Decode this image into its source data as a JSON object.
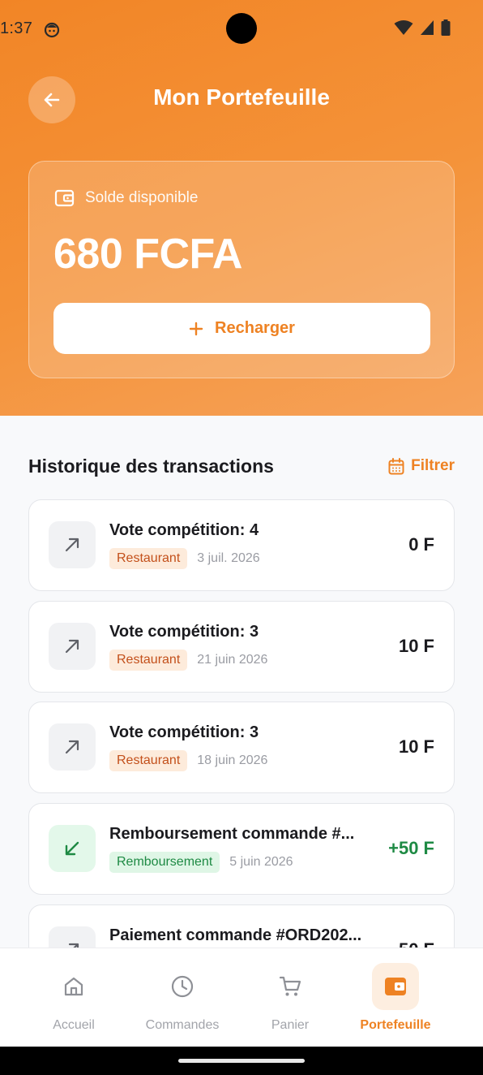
{
  "status_bar": {
    "time": "1:37"
  },
  "header": {
    "title": "Mon Portefeuille"
  },
  "balance": {
    "label": "Solde disponible",
    "amount": "680 FCFA",
    "recharge_label": "Recharger"
  },
  "history": {
    "title": "Historique des transactions",
    "filter_label": "Filtrer"
  },
  "transactions": [
    {
      "title": "Vote compétition: 4",
      "badge": "Restaurant",
      "date": "3 juil. 2026",
      "amount": "0 F",
      "direction": "out"
    },
    {
      "title": "Vote compétition: 3",
      "badge": "Restaurant",
      "date": "21 juin 2026",
      "amount": "10 F",
      "direction": "out"
    },
    {
      "title": "Vote compétition: 3",
      "badge": "Restaurant",
      "date": "18 juin 2026",
      "amount": "10 F",
      "direction": "out"
    },
    {
      "title": "Remboursement commande #...",
      "badge": "Remboursement",
      "date": "5 juin 2026",
      "amount": "+50 F",
      "direction": "in"
    },
    {
      "title": "Paiement commande #ORD202...",
      "badge": "",
      "date": "",
      "amount": "50 F",
      "direction": "out"
    }
  ],
  "bottom_nav": {
    "items": [
      {
        "label": "Accueil",
        "icon": "home-icon"
      },
      {
        "label": "Commandes",
        "icon": "clock-icon"
      },
      {
        "label": "Panier",
        "icon": "cart-icon"
      },
      {
        "label": "Portefeuille",
        "icon": "wallet-icon"
      }
    ],
    "active": "Portefeuille"
  },
  "colors": {
    "primary": "#EE8223",
    "positive": "#1E8A44",
    "badge_restaurant_bg": "#FDEBDB",
    "badge_refund_bg": "#DFF6E6"
  }
}
